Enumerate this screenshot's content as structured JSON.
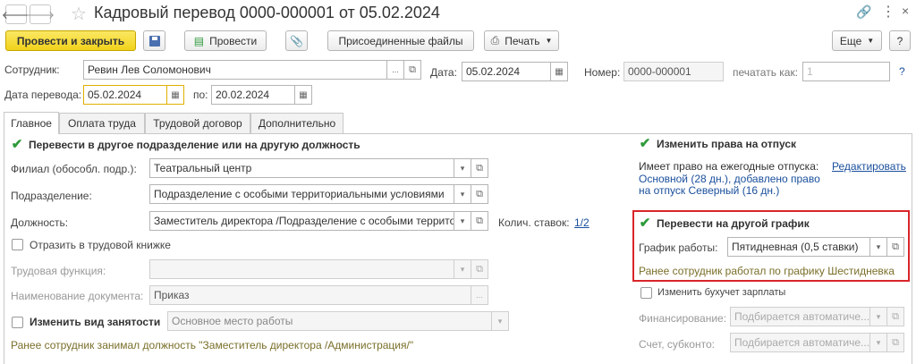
{
  "window": {
    "title": "Кадровый перевод 0000-000001 от 05.02.2024"
  },
  "icons": {
    "back": "arrow-left",
    "forward": "arrow-right",
    "star": "star",
    "link": "link",
    "more": "kebab",
    "close": "close",
    "save": "floppy",
    "post": "document-check",
    "attach": "paperclip",
    "print": "printer"
  },
  "toolbar": {
    "post_close": "Провести и закрыть",
    "post": "Провести",
    "attached_files": "Присоединенные файлы",
    "print": "Печать",
    "more": "Еще",
    "help": "?"
  },
  "header": {
    "employee_label": "Сотрудник:",
    "employee_value": "Ревин Лев Соломонович",
    "ellipsis": "...",
    "date_label": "Дата:",
    "date_value": "05.02.2024",
    "number_label": "Номер:",
    "number_value": "0000-000001",
    "print_as_label": "печатать как:",
    "print_as_placeholder": "1",
    "help": "?",
    "transfer_date_label": "Дата перевода:",
    "transfer_date_value": "05.02.2024",
    "to_label": "по:",
    "to_value": "20.02.2024"
  },
  "tabs": [
    "Главное",
    "Оплата труда",
    "Трудовой договор",
    "Дополнительно"
  ],
  "main": {
    "transfer_checkbox_label": "Перевести в другое подразделение или на другую должность",
    "branch_label": "Филиал (обособл. подр.):",
    "branch_value": "Театральный центр",
    "division_label": "Подразделение:",
    "division_value": "Подразделение с особыми территориальными условиями",
    "position_label": "Должность:",
    "position_value": "Заместитель директора /Подразделение с особыми территориальными условиями/",
    "rates_label": "Колич. ставок:",
    "rates_value": "1/2",
    "workbook_checkbox_label": "Отразить в трудовой книжке",
    "labor_function_label": "Трудовая функция:",
    "doc_name_label": "Наименование документа:",
    "doc_name_value": "Приказ",
    "ellipsis": "...",
    "employment_type_checkbox_label": "Изменить вид занятости",
    "employment_type_value": "Основное место работы",
    "prev_position_note": "Ранее сотрудник занимал должность \"Заместитель директора /Администрация/\""
  },
  "right": {
    "vacation_checkbox_label": "Изменить права на отпуск",
    "vacation_rights_label": "Имеет право на ежегодные отпуска:",
    "edit_link": "Редактировать",
    "vacation_rights_line1": "Основной (28 дн.), добавлено право",
    "vacation_rights_line2": "на отпуск Северный (16 дн.)",
    "schedule_checkbox_label": "Перевести на другой график",
    "schedule_label": "График работы:",
    "schedule_value": "Пятидневная (0,5 ставки)",
    "schedule_note": "Ранее сотрудник работал по графику Шестидневка",
    "accounting_checkbox_label": "Изменить бухучет зарплаты",
    "financing_label": "Финансирование:",
    "financing_value": "Подбирается автоматиче...",
    "account_label": "Счет, субконто:",
    "account_value": "Подбирается автоматиче..."
  },
  "colors": {
    "accent": "#f1d21a",
    "link": "#1a4f9c",
    "check": "#2e9a3a",
    "note": "#7a6f2a",
    "highlight_border": "#d9252a"
  }
}
